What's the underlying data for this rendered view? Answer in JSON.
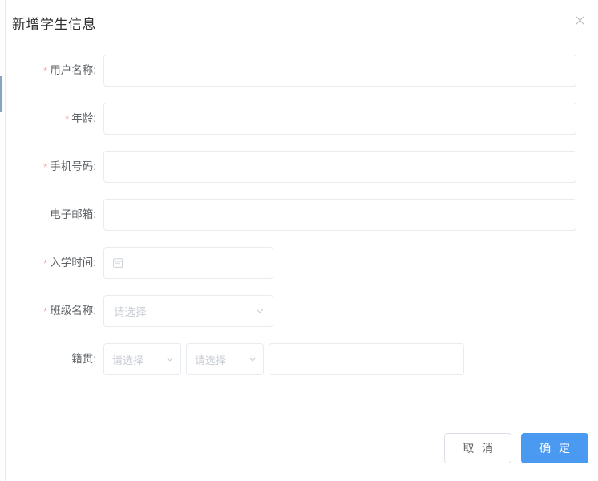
{
  "dialog": {
    "title": "新增学生信息",
    "close_icon": "close-icon"
  },
  "form": {
    "fields": [
      {
        "label": "用户名称:",
        "required": true,
        "type": "text",
        "value": "",
        "placeholder": ""
      },
      {
        "label": "年龄:",
        "required": true,
        "type": "text",
        "value": "",
        "placeholder": ""
      },
      {
        "label": "手机号码:",
        "required": true,
        "type": "text",
        "value": "",
        "placeholder": ""
      },
      {
        "label": "电子邮箱:",
        "required": false,
        "type": "text",
        "value": "",
        "placeholder": ""
      },
      {
        "label": "入学时间:",
        "required": true,
        "type": "date",
        "value": "",
        "placeholder": "",
        "icon": "calendar-icon"
      },
      {
        "label": "班级名称:",
        "required": true,
        "type": "select",
        "value": "请选择",
        "icon": "chevron-down-icon"
      },
      {
        "label": "籍贯:",
        "required": false,
        "type": "region",
        "province": "请选择",
        "city": "请选择",
        "detail": "",
        "detail_placeholder": "",
        "icon": "chevron-down-icon"
      }
    ],
    "required_marker": "*"
  },
  "footer": {
    "cancel_label": "取 消",
    "confirm_label": "确 定"
  },
  "colors": {
    "primary": "#4a9af2",
    "required_star": "#f7a8a8",
    "label_text": "#5e6266",
    "placeholder": "#c9cdd4",
    "border": "#e8ebef"
  }
}
